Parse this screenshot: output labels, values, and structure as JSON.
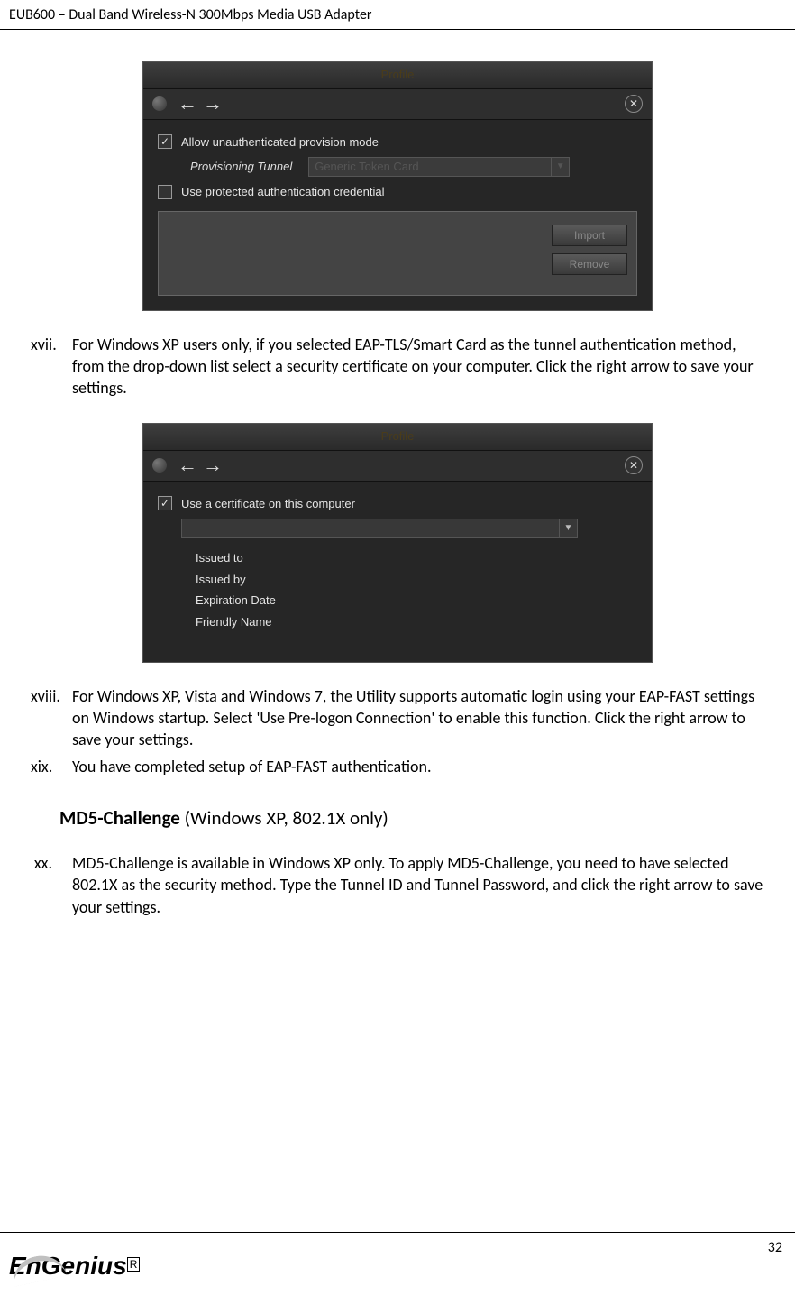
{
  "header": "EUB600 – Dual Band Wireless-N 300Mbps Media USB Adapter",
  "page_number": "32",
  "dialog1": {
    "title": "Profile",
    "chk_allow": "Allow unauthenticated provision mode",
    "prov_label": "Provisioning Tunnel",
    "prov_value": "Generic Token Card",
    "chk_protected": "Use protected authentication credential",
    "btn_import": "Import",
    "btn_remove": "Remove"
  },
  "items": {
    "xvii_num": "xvii.",
    "xvii_txt": "For Windows XP users only, if you selected EAP-TLS/Smart Card as the tunnel authentication method, from the drop-down list select a security certificate on your computer. Click the right arrow to save your settings.",
    "xviii_num": "xviii.",
    "xviii_txt": "For Windows XP, Vista and Windows 7, the Utility supports automatic login using your EAP-FAST settings on Windows startup. Select 'Use Pre-logon Connection' to enable this function. Click the right arrow to save your settings.",
    "xix_num": "xix.",
    "xix_txt": "You have completed setup of EAP-FAST authentication.",
    "xx_num": "xx.",
    "xx_txt": "MD5-Challenge is available in Windows XP only. To apply MD5-Challenge, you need to have selected 802.1X as the security method. Type the Tunnel ID and Tunnel Password, and click the right arrow to save your settings."
  },
  "dialog2": {
    "title": "Profile",
    "chk_cert": "Use a certificate on this computer",
    "fields": {
      "issued_to": "Issued to",
      "issued_by": "Issued by",
      "expiration": "Expiration Date",
      "friendly": "Friendly Name"
    }
  },
  "heading": {
    "bold": "MD5-Challenge",
    "rest": "  (Windows XP, 802.1X only)"
  },
  "logo": {
    "en": "En",
    "genius": "Genius",
    "reg": "R"
  }
}
